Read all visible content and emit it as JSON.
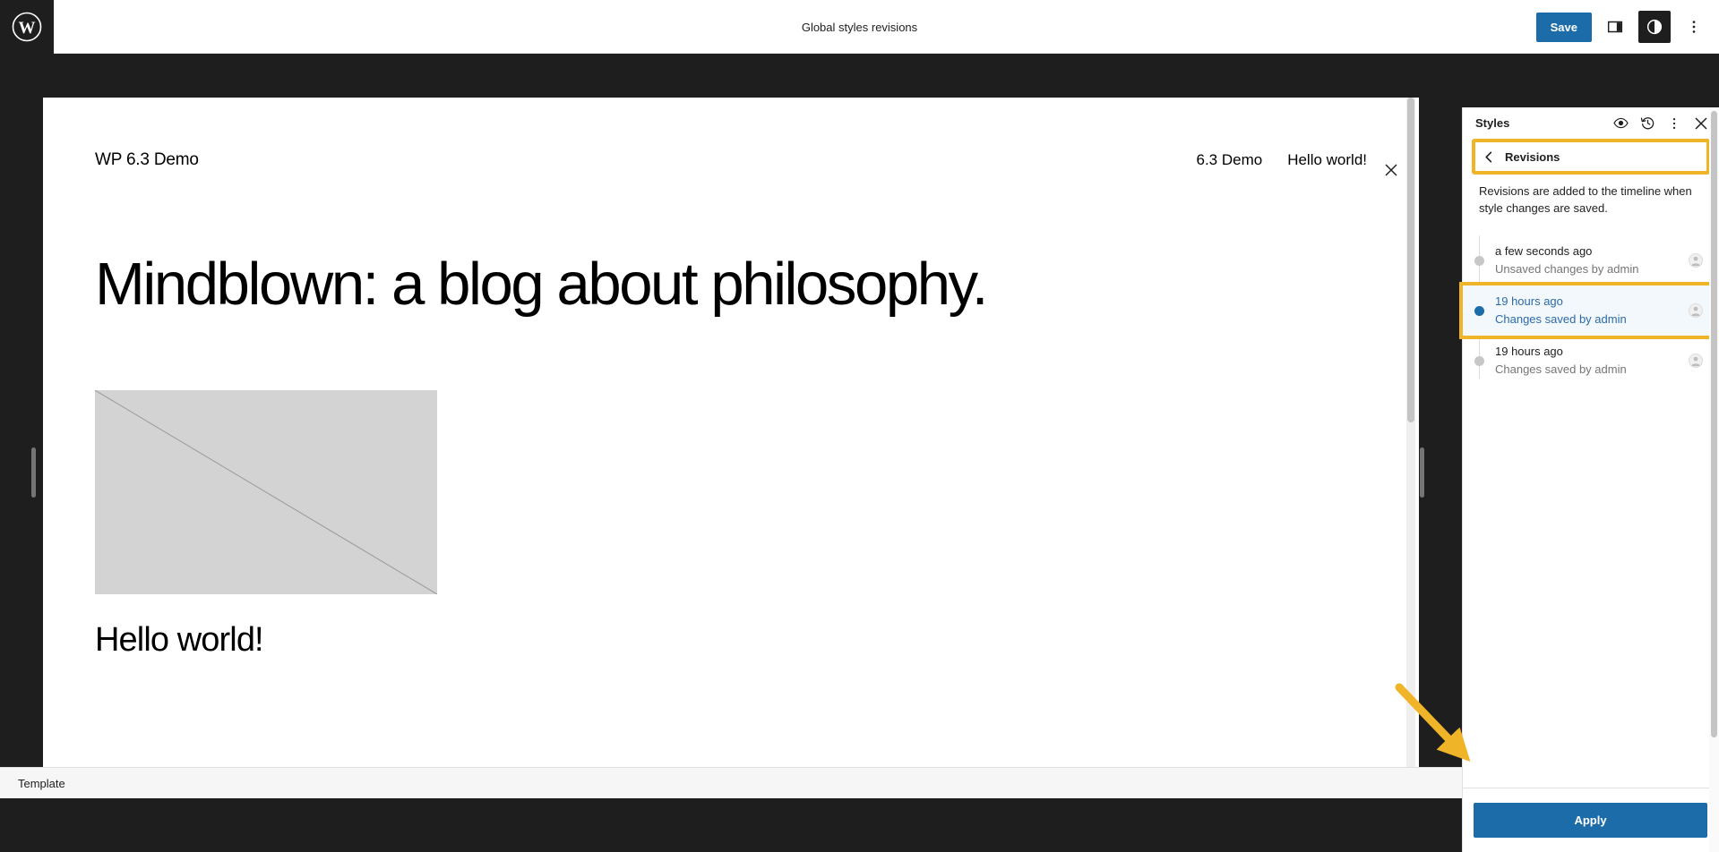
{
  "topbar": {
    "logo_icon": "wordpress-logo-icon",
    "title": "Global styles revisions",
    "save_label": "Save",
    "sidebar_toggle_icon": "sidebar-toggle-icon",
    "styles_icon": "styles-contrast-icon",
    "options_icon": "more-options-vertical-dots-icon"
  },
  "canvas": {
    "close_icon": "close-x-icon",
    "site_title": "WP 6.3 Demo",
    "nav_links": [
      "6.3 Demo",
      "Hello world!"
    ],
    "hero_heading": "Mindblown: a blog about philosophy.",
    "image_placeholder_name": "image-placeholder",
    "post_title": "Hello world!"
  },
  "statusbar": {
    "label": "Template"
  },
  "styles_panel": {
    "title": "Styles",
    "header_icons": {
      "preview": "eye-icon",
      "revisions": "history-clock-icon",
      "more": "more-options-vertical-dots-icon",
      "close": "close-x-icon"
    },
    "back_icon": "chevron-left-icon",
    "back_label": "Revisions",
    "description": "Revisions are added to the timeline when style changes are saved.",
    "revisions": [
      {
        "when": "a few seconds ago",
        "who": "Unsaved changes by admin",
        "selected": false,
        "avatar_icon": "user-avatar-icon"
      },
      {
        "when": "19 hours ago",
        "who": "Changes saved by admin",
        "selected": true,
        "avatar_icon": "user-avatar-icon"
      },
      {
        "when": "19 hours ago",
        "who": "Changes saved by admin",
        "selected": false,
        "avatar_icon": "user-avatar-icon"
      }
    ],
    "apply_label": "Apply"
  },
  "annotations": {
    "highlight_color": "#f0b429",
    "arrow_name": "annotation-arrow-to-apply-button"
  },
  "colors": {
    "accent_blue": "#1b6ca8",
    "chrome_dark": "#1e1e1e",
    "highlight_orange": "#f0b429",
    "selected_row_bg": "#f3f8fc"
  }
}
